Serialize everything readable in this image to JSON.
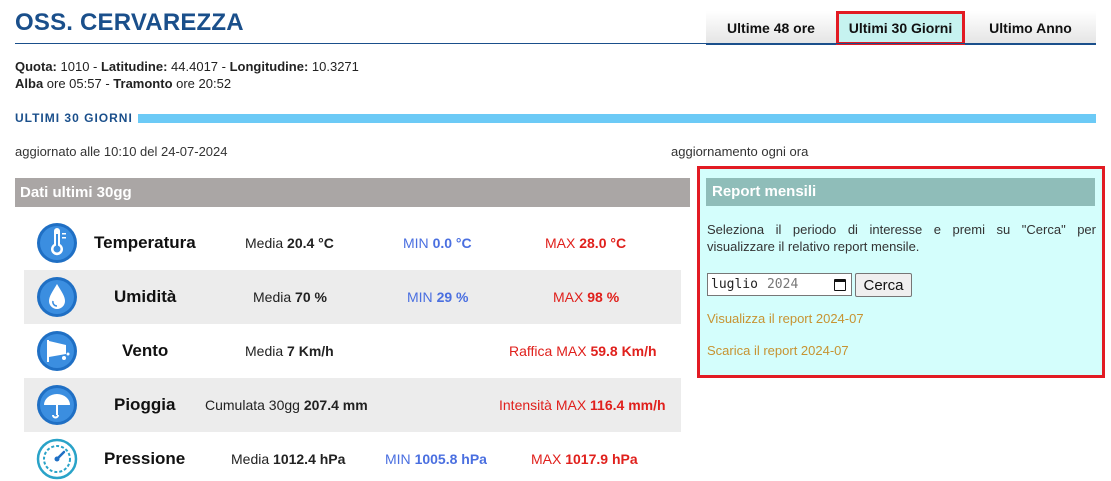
{
  "station": {
    "title": "OSS. CERVAREZZA"
  },
  "tabs": [
    {
      "label": "Ultime 48 ore"
    },
    {
      "label": "Ultimi 30 Giorni"
    },
    {
      "label": "Ultimo Anno"
    }
  ],
  "info": {
    "quota_label": "Quota:",
    "quota_value": " 1010 - ",
    "lat_label": "Latitudine:",
    "lat_value": " 44.4017 - ",
    "lon_label": "Longitudine:",
    "lon_value": " 10.3271",
    "alba_label": "Alba",
    "alba_value": " ore 05:57 - ",
    "tramonto_label": "Tramonto",
    "tramonto_value": " ore 20:52"
  },
  "section": {
    "title": "ULTIMI 30 GIORNI"
  },
  "updated": "aggiornato alle 10:10 del 24-07-2024",
  "update_freq": "aggiornamento ogni ora",
  "panel": {
    "title": "Dati ultimi 30gg"
  },
  "rows": [
    {
      "name": "Temperatura",
      "icon": "thermometer-icon",
      "c1_label": "Media ",
      "c1_value": "20.4 °C",
      "c2_label": "MIN ",
      "c2_value": "0.0 °C",
      "c3_label": "MAX ",
      "c3_value": "28.0 °C"
    },
    {
      "name": "Umidità",
      "icon": "water-drop-icon",
      "c1_label": "Media ",
      "c1_value": "70 %",
      "c2_label": "MIN ",
      "c2_value": "29 %",
      "c3_label": "MAX ",
      "c3_value": "98 %"
    },
    {
      "name": "Vento",
      "icon": "wind-icon",
      "c1_label": "Media ",
      "c1_value": "7 Km/h",
      "c3_label": "Raffica MAX ",
      "c3_value": "59.8 Km/h"
    },
    {
      "name": "Pioggia",
      "icon": "umbrella-icon",
      "c1_label": "Cumulata 30gg ",
      "c1_value": "207.4 mm",
      "c3_label": "Intensità MAX ",
      "c3_value": "116.4 mm/h"
    },
    {
      "name": "Pressione",
      "icon": "gauge-icon",
      "c1_label": "Media ",
      "c1_value": "1012.4 hPa",
      "c2_label": "MIN ",
      "c2_value": "1005.8 hPa",
      "c3_label": "MAX ",
      "c3_value": "1017.9 hPa"
    }
  ],
  "report": {
    "title": "Report mensili",
    "description": "Seleziona il periodo di interesse e premi su \"Cerca\" per visualizzare il relativo report mensile.",
    "month_value": "luglio",
    "year_value": "2024",
    "search_label": "Cerca",
    "view_link": "Visualizza il report 2024-07",
    "download_link": "Scarica il report 2024-07"
  },
  "colors": {
    "brand_blue": "#1a4f8b",
    "accent_bar": "#6ccaf6",
    "highlight_red": "#e21b23",
    "report_bg": "#d4fefc",
    "link_gold": "#c79332",
    "min_blue": "#4a6fe0",
    "max_red": "#e0201c"
  }
}
